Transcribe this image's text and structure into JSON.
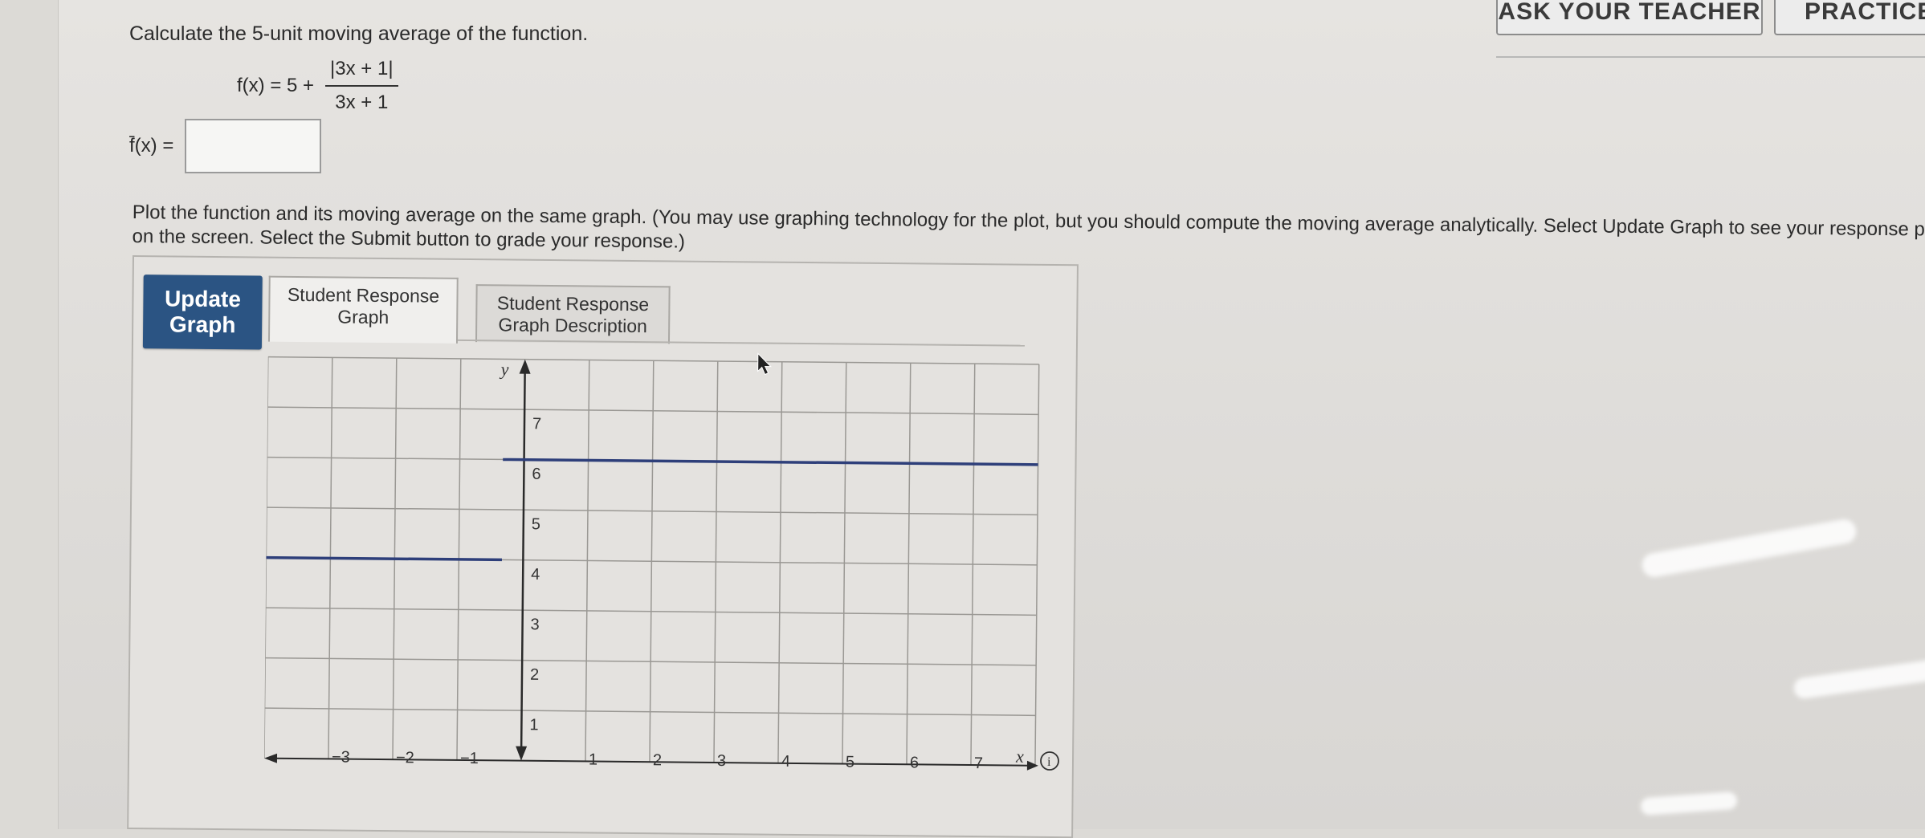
{
  "header": {
    "ask_teacher_label": "ASK YOUR TEACHER",
    "practice_label": "PRACTICE ANOTH"
  },
  "question": {
    "prompt": "Calculate the 5-unit moving average of the function.",
    "function_lhs": "f(x) = 5 +",
    "numerator": "|3x + 1|",
    "denominator": "3x + 1",
    "answer_label": "f̄(x) =",
    "answer_value": ""
  },
  "instructions": {
    "text": "Plot the function and its moving average on the same graph. (You may use graphing technology for the plot, but you should compute the moving average analytically. Select Update Graph to see your response plotted on the screen. Select the Submit button to grade your response.)"
  },
  "graph_panel": {
    "update_button_line1": "Update",
    "update_button_line2": "Graph",
    "tab_graph_line1": "Student Response",
    "tab_graph_line2": "Graph",
    "tab_desc_line1": "Student Response",
    "tab_desc_line2": "Graph Description",
    "info_icon_label": "i"
  },
  "chart_data": {
    "type": "line",
    "title": "",
    "xlabel": "x",
    "ylabel": "y",
    "xlim": [
      -4,
      8
    ],
    "ylim": [
      0,
      8
    ],
    "x_ticks": [
      -3,
      -2,
      -1,
      1,
      2,
      3,
      4,
      5,
      6,
      7
    ],
    "y_ticks": [
      1,
      2,
      3,
      4,
      5,
      6,
      7
    ],
    "grid": true,
    "series": [
      {
        "x": [
          -4,
          -0.33
        ],
        "y": [
          4,
          4
        ]
      },
      {
        "x": [
          -0.33,
          8
        ],
        "y": [
          6,
          6
        ]
      }
    ],
    "colors": {
      "series": "#2e3f7a",
      "grid": "#9a9894",
      "axis": "#2a2a2a"
    }
  }
}
